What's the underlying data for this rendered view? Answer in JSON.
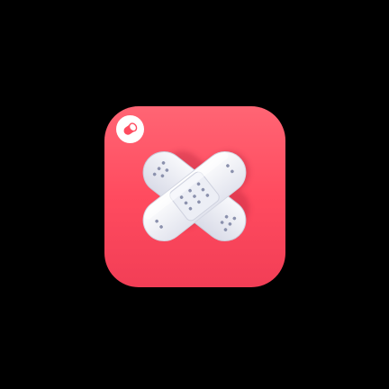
{
  "app_icon": {
    "name": "bandage-icon",
    "background_color": "#ff4b5f",
    "background_shadow_color": "#d92f46",
    "bandage_color": "#f6f7fb",
    "bandage_shade_color": "#d9dbe7",
    "hole_color": "#8b91ad"
  },
  "badge": {
    "name": "pill-icon",
    "background_color": "#ffffff",
    "icon_color": "#ff4b5f"
  }
}
